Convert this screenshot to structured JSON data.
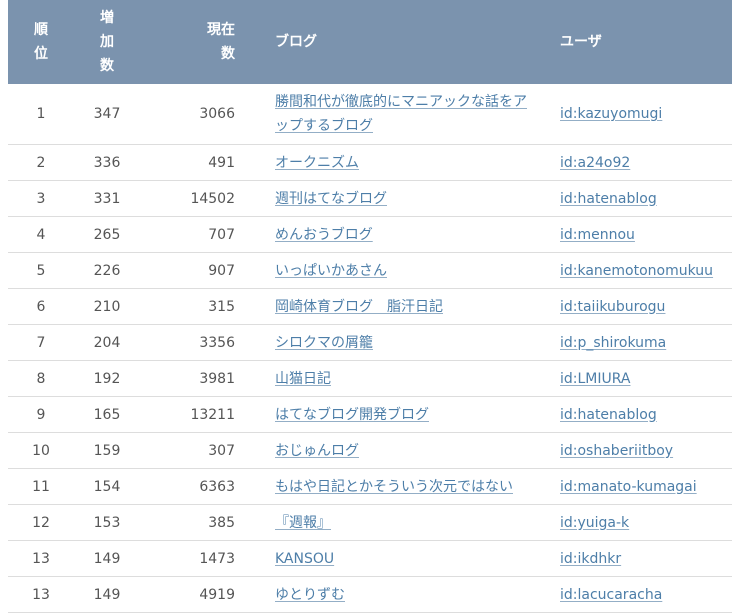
{
  "table": {
    "headers": {
      "rank": "順\n位",
      "increase": "増\n加\n数",
      "current": "現在\n数",
      "blog": "ブログ",
      "user": "ユーザ"
    },
    "rows": [
      {
        "rank": "1",
        "increase": "347",
        "current": "3066",
        "blog": "勝間和代が徹底的にマニアックな話をアップするブログ",
        "user": "id:kazuyomugi"
      },
      {
        "rank": "2",
        "increase": "336",
        "current": "491",
        "blog": "オークニズム",
        "user": "id:a24o92"
      },
      {
        "rank": "3",
        "increase": "331",
        "current": "14502",
        "blog": "週刊はてなブログ",
        "user": "id:hatenablog"
      },
      {
        "rank": "4",
        "increase": "265",
        "current": "707",
        "blog": "めんおうブログ",
        "user": "id:mennou"
      },
      {
        "rank": "5",
        "increase": "226",
        "current": "907",
        "blog": "いっぱいかあさん",
        "user": "id:kanemotonomukuu"
      },
      {
        "rank": "6",
        "increase": "210",
        "current": "315",
        "blog": "岡崎体育ブログ　脂汗日記",
        "user": "id:taiikuburogu"
      },
      {
        "rank": "7",
        "increase": "204",
        "current": "3356",
        "blog": "シロクマの屑籠",
        "user": "id:p_shirokuma"
      },
      {
        "rank": "8",
        "increase": "192",
        "current": "3981",
        "blog": "山猫日記",
        "user": "id:LMIURA"
      },
      {
        "rank": "9",
        "increase": "165",
        "current": "13211",
        "blog": "はてなブログ開発ブログ",
        "user": "id:hatenablog"
      },
      {
        "rank": "10",
        "increase": "159",
        "current": "307",
        "blog": "おじゅんログ",
        "user": "id:oshaberiitboy"
      },
      {
        "rank": "11",
        "increase": "154",
        "current": "6363",
        "blog": "もはや日記とかそういう次元ではない",
        "user": "id:manato-kumagai"
      },
      {
        "rank": "12",
        "increase": "153",
        "current": "385",
        "blog": "『週報』",
        "user": "id:yuiga-k"
      },
      {
        "rank": "13",
        "increase": "149",
        "current": "1473",
        "blog": "KANSOU",
        "user": "id:ikdhkr"
      },
      {
        "rank": "13",
        "increase": "149",
        "current": "4919",
        "blog": "ゆとりずむ",
        "user": "id:lacucaracha"
      }
    ]
  },
  "colors": {
    "header_bg": "#7b93ae",
    "header_text": "#ffffff",
    "link": "#4d7ea8",
    "body_text": "#555555",
    "row_divider": "#dddddd"
  }
}
